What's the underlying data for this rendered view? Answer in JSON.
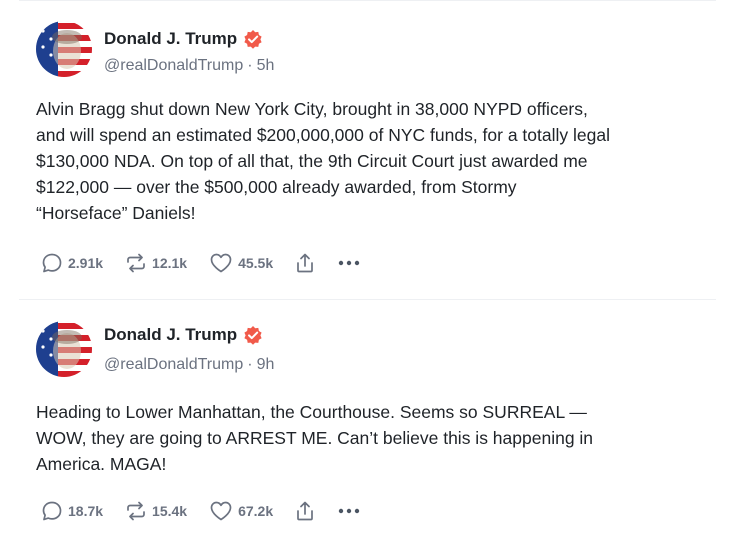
{
  "posts": [
    {
      "author": {
        "name": "Donald J. Trump",
        "handle": "@realDonaldTrump",
        "time": "5h"
      },
      "lines": [
        "Alvin Bragg shut down New York City, brought in 38,000 NYPD officers,",
        "and will spend an estimated $200,000,000 of NYC funds, for a totally legal",
        "$130,000 NDA. On top of all that, the 9th Circuit Court just awarded me",
        "$122,000 — over the $500,000 already awarded, from Stormy",
        "“Horseface” Daniels!"
      ],
      "stats": {
        "replies": "2.91k",
        "reposts": "12.1k",
        "likes": "45.5k"
      }
    },
    {
      "author": {
        "name": "Donald J. Trump",
        "handle": "@realDonaldTrump",
        "time": "9h"
      },
      "lines": [
        "Heading to Lower Manhattan, the Courthouse. Seems so SURREAL —",
        "WOW, they are going to ARREST ME. Can’t believe this is happening in",
        "America. MAGA!"
      ],
      "stats": {
        "replies": "18.7k",
        "reposts": "15.4k",
        "likes": "67.2k"
      }
    }
  ],
  "meta_separator": "·",
  "icons": {
    "reply": "speech-bubble-icon",
    "repost": "repost-arrows-icon",
    "like": "heart-icon",
    "share": "share-upload-icon",
    "more": "more-dots-icon",
    "verified": "verified-badge-icon"
  },
  "colors": {
    "verified": "#f15a4a",
    "muted": "#6b7280",
    "text": "#1f2328",
    "divider": "#eef0f3"
  }
}
